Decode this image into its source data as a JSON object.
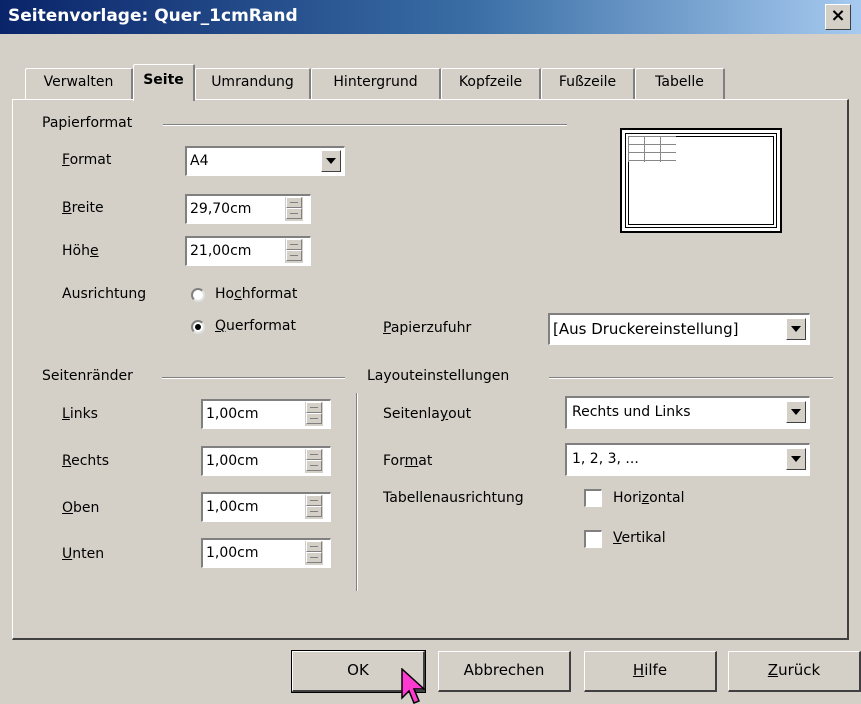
{
  "window": {
    "title": "Seitenvorlage: Quer_1cmRand",
    "close_glyph": "×"
  },
  "tabs": [
    {
      "label": "Verwalten",
      "active": false
    },
    {
      "label": "Seite",
      "active": true
    },
    {
      "label": "Umrandung",
      "active": false
    },
    {
      "label": "Hintergrund",
      "active": false
    },
    {
      "label": "Kopfzeile",
      "active": false
    },
    {
      "label": "Fußzeile",
      "active": false
    },
    {
      "label": "Tabelle",
      "active": false
    }
  ],
  "papierformat": {
    "heading": "Papierformat",
    "format": {
      "label_pre": "",
      "label_ul": "F",
      "label_post": "ormat",
      "value": "A4"
    },
    "breite": {
      "label_pre": "",
      "label_ul": "B",
      "label_post": "reite",
      "value": "29,70cm"
    },
    "hoehe": {
      "label_pre": "Höh",
      "label_ul": "e",
      "label_post": "",
      "value": "21,00cm"
    },
    "ausrichtung": {
      "label": "Ausrichtung",
      "hochformat": {
        "label_pre": "Ho",
        "label_ul": "c",
        "label_post": "hformat",
        "selected": false
      },
      "querformat": {
        "label_pre": "",
        "label_ul": "Q",
        "label_post": "uerformat",
        "selected": true
      }
    },
    "papierzufuhr": {
      "label_pre": "",
      "label_ul": "P",
      "label_post": "apierzufuhr",
      "value": "[Aus Druckereinstellung]"
    }
  },
  "seitenraender": {
    "heading": "Seitenränder",
    "links": {
      "label_pre": "",
      "label_ul": "L",
      "label_post": "inks",
      "value": "1,00cm"
    },
    "rechts": {
      "label_pre": "",
      "label_ul": "R",
      "label_post": "echts",
      "value": "1,00cm"
    },
    "oben": {
      "label_pre": "",
      "label_ul": "O",
      "label_post": "ben",
      "value": "1,00cm"
    },
    "unten": {
      "label_pre": "",
      "label_ul": "U",
      "label_post": "nten",
      "value": "1,00cm"
    }
  },
  "layout": {
    "heading": "Layouteinstellungen",
    "seitenlayout": {
      "label_pre": "Seitenla",
      "label_ul": "y",
      "label_post": "out",
      "value": "Rechts und Links"
    },
    "format": {
      "label_pre": "For",
      "label_ul": "m",
      "label_post": "at",
      "value": "1, 2, 3, ..."
    },
    "tabellenausrichtung": {
      "label": "Tabellenausrichtung",
      "horizontal": {
        "label_pre": "Hori",
        "label_ul": "z",
        "label_post": "ontal",
        "checked": false
      },
      "vertikal": {
        "label_pre": "",
        "label_ul": "V",
        "label_post": "ertikal",
        "checked": false
      }
    }
  },
  "buttons": {
    "ok": "OK",
    "abbrechen": "Abbrechen",
    "hilfe": {
      "label_pre": "",
      "label_ul": "H",
      "label_post": "ilfe"
    },
    "zurueck": {
      "label_pre": "",
      "label_ul": "Z",
      "label_post": "urück"
    }
  },
  "icons": {
    "close": "close-icon",
    "dropdown": "chevron-down-icon",
    "cursor": "mouse-pointer-icon"
  },
  "colors": {
    "titlebar_start": "#0a246a",
    "titlebar_end": "#a6caf0",
    "face": "#d4d0c8",
    "cursor": "#ff3ad0"
  }
}
